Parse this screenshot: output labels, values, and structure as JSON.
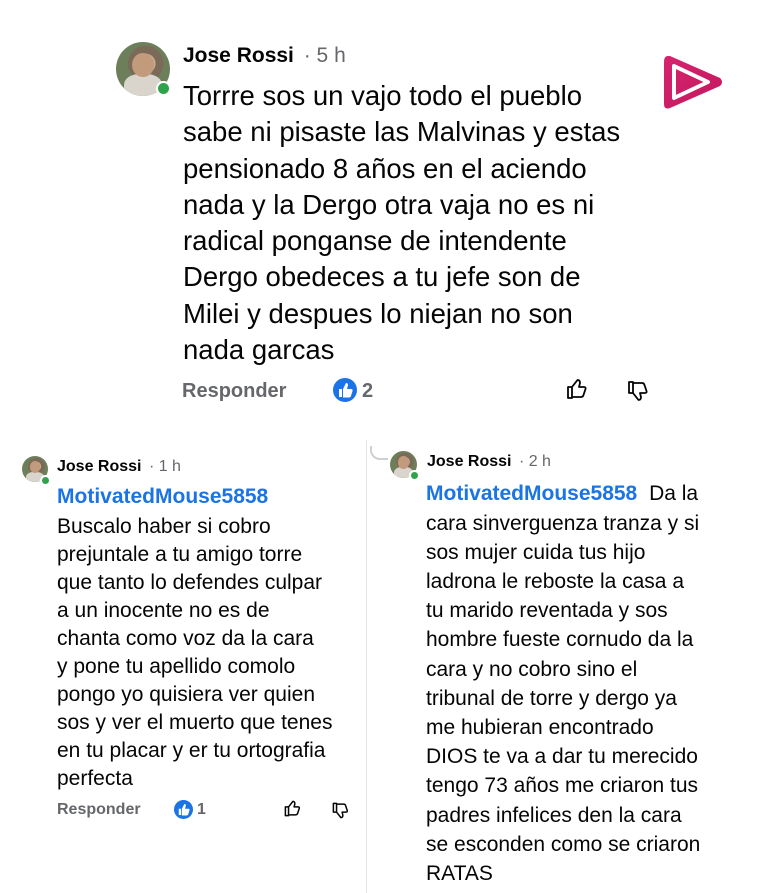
{
  "main_comment": {
    "author": "Jose Rossi",
    "time": "· 5 h",
    "text": "Torrre sos un vajo todo el pueblo\nsabe ni pisaste las Malvinas y estas\npensionado 8 años en  el  aciendo\nnada y la Dergo otra vaja no es ni\nradical ponganse de intendente\nDergo obedeces a tu jefe  son de\nMilei y despues lo niejan no son\nnada garcas",
    "reply_label": "Responder",
    "like_count": "2"
  },
  "reply_left": {
    "author": "Jose Rossi",
    "time": "· 1 h",
    "mention": "MotivatedMouse5858",
    "text": "Buscalo haber si cobro\nprejuntale a tu amigo torre\nque tanto lo defendes culpar\na un inocente no es de\nchanta como voz  da la cara\ny pone tu apellido comolo\npongo yo quisiera ver quien\nsos y ver el muerto que tenes\nen tu placar y er tu ortografia\nperfecta",
    "reply_label": "Responder",
    "like_count": "1"
  },
  "reply_right": {
    "author": "Jose Rossi",
    "time": "· 2 h",
    "mention": "MotivatedMouse5858",
    "text_first": "Da la",
    "text": "cara sinverguenza tranza y si\nsos mujer cuida tus hijo\nladrona le reboste la casa a\ntu marido reventada y sos\nhombre fueste cornudo da la\ncara y no cobro sino el\ntribunal de torre y dergo ya\nme hubieran encontrado\nDIOS te va a dar tu merecido\ntengo 73 años me criaron tus\npadres infelices den la cara\nse esconden como se criaron\nRATAS"
  },
  "icons": {
    "brand_logo": "play-logo-icon",
    "like_badge": "like-badge-icon",
    "like": "thumbs-up-icon",
    "dislike": "thumbs-down-icon"
  },
  "colors": {
    "link_blue": "#1b74e4",
    "meta_gray": "#65676b",
    "online_green": "#31a24c",
    "logo_magenta": "#d6246e"
  }
}
